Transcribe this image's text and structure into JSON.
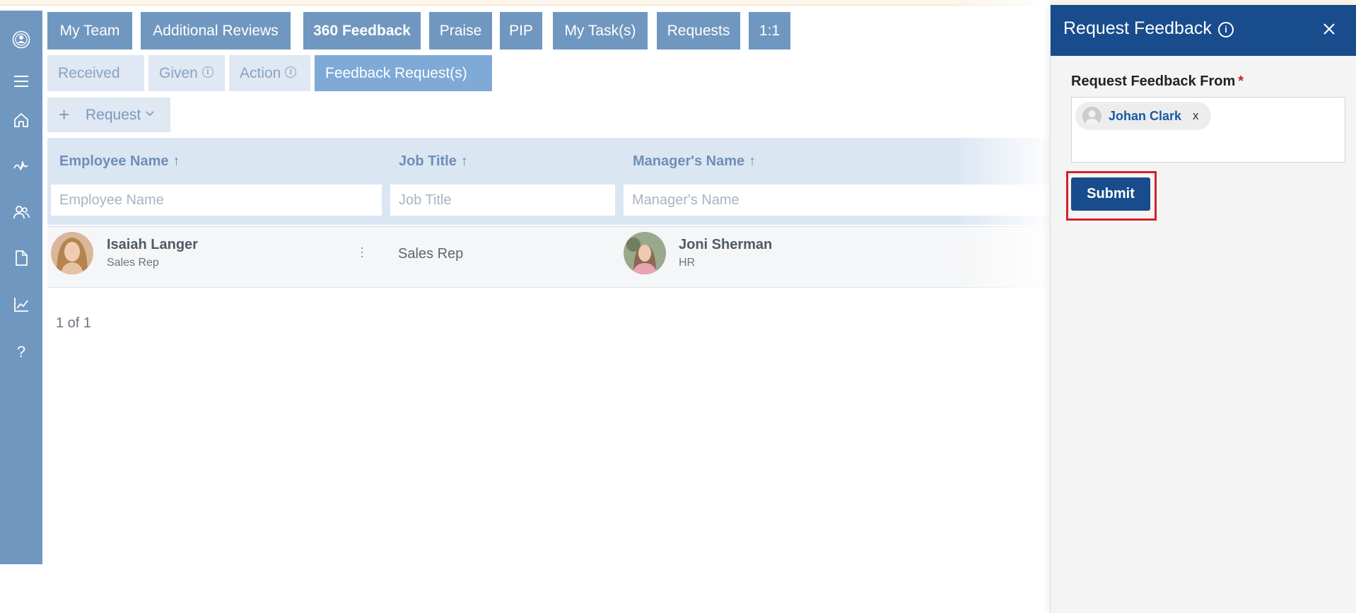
{
  "tabs_primary": [
    {
      "label": "My Team"
    },
    {
      "label": "Additional Reviews"
    },
    {
      "label": "360 Feedback"
    },
    {
      "label": "Praise"
    },
    {
      "label": "PIP"
    },
    {
      "label": "My Task(s)"
    },
    {
      "label": "Requests"
    },
    {
      "label": "1:1"
    }
  ],
  "tabs_secondary": [
    {
      "label": "Received"
    },
    {
      "label": "Given"
    },
    {
      "label": "Action"
    },
    {
      "label": "Feedback Request(s)"
    }
  ],
  "request_button": {
    "label": "Request"
  },
  "grid": {
    "columns": [
      {
        "label": "Employee Name",
        "placeholder": "Employee Name"
      },
      {
        "label": "Job Title",
        "placeholder": "Job Title"
      },
      {
        "label": "Manager's Name",
        "placeholder": "Manager's Name"
      }
    ],
    "rows": [
      {
        "employee_name": "Isaiah Langer",
        "employee_title": "Sales Rep",
        "job_title": "Sales Rep",
        "manager_name": "Joni Sherman",
        "manager_title": "HR"
      }
    ],
    "pager": "1 of 1"
  },
  "panel": {
    "title": "Request Feedback",
    "field_label": "Request Feedback From",
    "required_marker": "*",
    "selected_person": "Johan Clark",
    "remove_label": "x",
    "submit_label": "Submit"
  },
  "colors": {
    "header_blue": "#184c8c",
    "tab_blue": "#7097bf",
    "highlight_red": "#d5202c"
  }
}
